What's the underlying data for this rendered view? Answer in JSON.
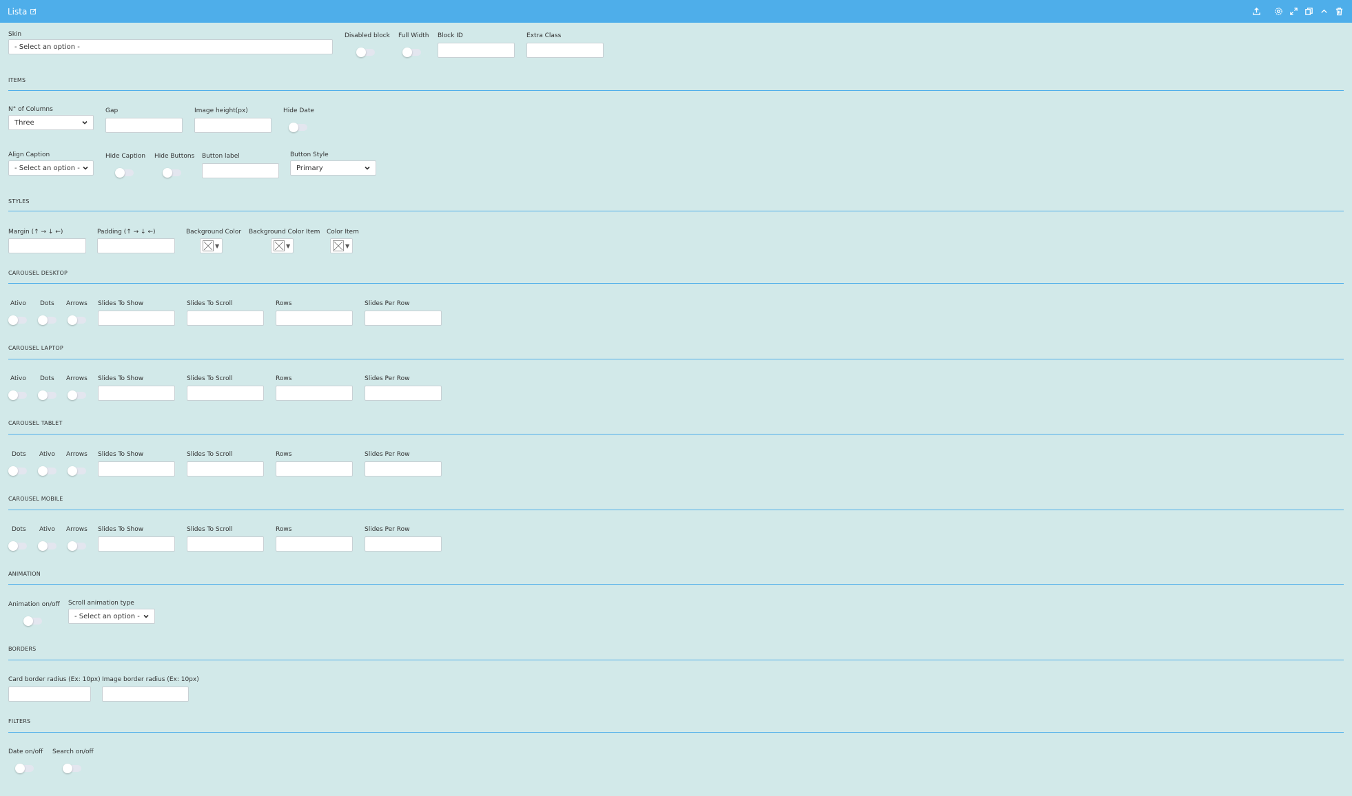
{
  "header": {
    "title": "Lista",
    "colors": {
      "bar": "#4eaeea",
      "background": "#d2e9e9"
    }
  },
  "general": {
    "skin_label": "Skin",
    "skin_value": "- Select an option -",
    "disabled_block_label": "Disabled block",
    "full_width_label": "Full Width",
    "block_id_label": "Block ID",
    "extra_class_label": "Extra Class"
  },
  "items": {
    "section": "ITEMS",
    "columns_label": "N° of Columns",
    "columns_value": "Three",
    "gap_label": "Gap",
    "image_height_label": "Image height(px)",
    "hide_date_label": "Hide Date",
    "align_caption_label": "Align Caption",
    "align_caption_value": "- Select an option -",
    "hide_caption_label": "Hide Caption",
    "hide_buttons_label": "Hide Buttons",
    "button_label_label": "Button label",
    "button_style_label": "Button Style",
    "button_style_value": "Primary"
  },
  "styles": {
    "section": "STYLES",
    "margin_label": "Margin (↑ → ↓ ←)",
    "padding_label": "Padding (↑ → ↓ ←)",
    "bg_color_label": "Background Color",
    "bg_color_item_label": "Background Color Item",
    "color_item_label": "Color Item"
  },
  "carousel_desktop": {
    "section": "CAROUSEL DESKTOP",
    "t1": "Ativo",
    "t2": "Dots",
    "t3": "Arrows",
    "f1": "Slides To Show",
    "f2": "Slides To Scroll",
    "f3": "Rows",
    "f4": "Slides Per Row"
  },
  "carousel_laptop": {
    "section": "CAROUSEL LAPTOP",
    "t1": "Ativo",
    "t2": "Dots",
    "t3": "Arrows",
    "f1": "Slides To Show",
    "f2": "Slides To Scroll",
    "f3": "Rows",
    "f4": "Slides Per Row"
  },
  "carousel_tablet": {
    "section": "CAROUSEL TABLET",
    "t1": "Dots",
    "t2": "Ativo",
    "t3": "Arrows",
    "f1": "Slides To Show",
    "f2": "Slides To Scroll",
    "f3": "Rows",
    "f4": "Slides Per Row"
  },
  "carousel_mobile": {
    "section": "CAROUSEL MOBILE",
    "t1": "Dots",
    "t2": "Ativo",
    "t3": "Arrows",
    "f1": "Slides To Show",
    "f2": "Slides To Scroll",
    "f3": "Rows",
    "f4": "Slides Per Row"
  },
  "animation": {
    "section": "ANIMATION",
    "onoff_label": "Animation on/off",
    "type_label": "Scroll animation type",
    "type_value": "- Select an option -"
  },
  "borders": {
    "section": "BORDERS",
    "card_radius_label": "Card border radius (Ex: 10px)",
    "image_radius_label": "Image border radius (Ex: 10px)"
  },
  "filters": {
    "section": "FILTERS",
    "date_label": "Date on/off",
    "search_label": "Search on/off"
  }
}
